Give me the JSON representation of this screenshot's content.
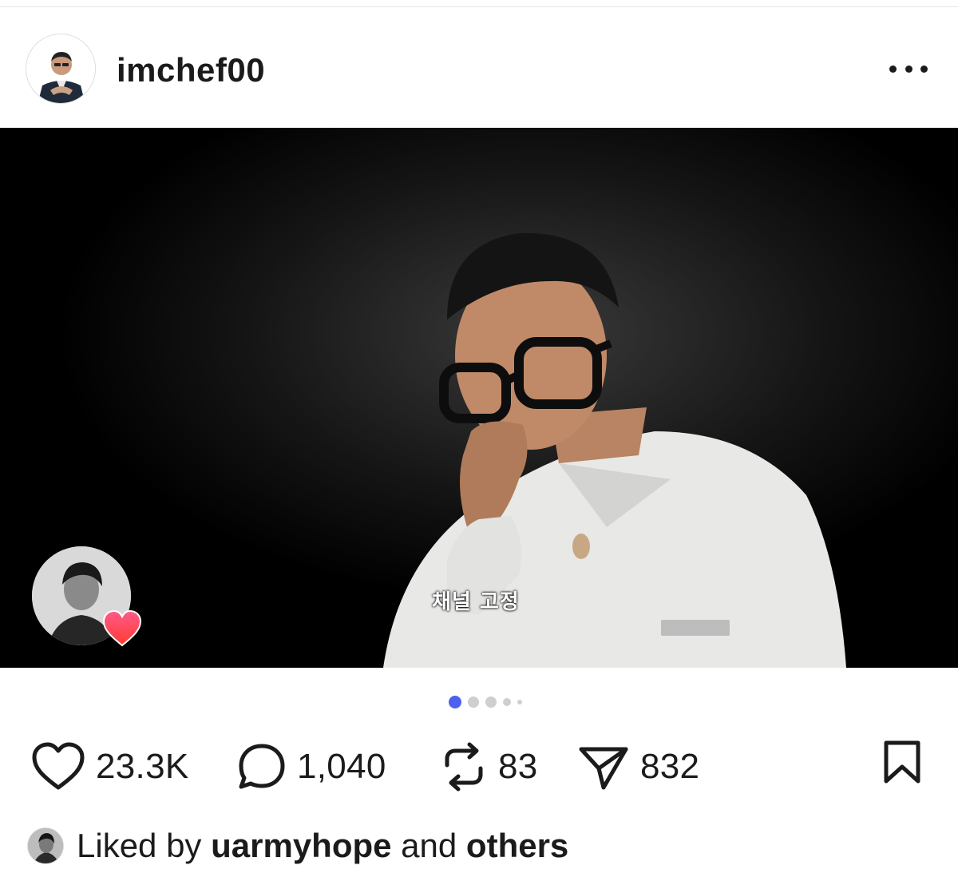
{
  "post": {
    "username": "imchef00",
    "more_label": "More options"
  },
  "media": {
    "subtitle": "채널 고정",
    "carousel": {
      "total": 5,
      "active_index": 0,
      "active_color": "#4c61f0"
    }
  },
  "actions": {
    "likes": "23.3K",
    "comments": "1,040",
    "reposts": "83",
    "shares": "832"
  },
  "liked_by": {
    "prefix": "Liked by",
    "user": "uarmyhope",
    "connector": "and",
    "suffix": "others"
  },
  "icons": {
    "more": "more-horizontal-icon",
    "heart": "heart-icon",
    "comment": "comment-bubble-icon",
    "repost": "repost-icon",
    "share": "paper-plane-icon",
    "bookmark": "bookmark-icon",
    "reaction": "heart-reaction-icon"
  }
}
